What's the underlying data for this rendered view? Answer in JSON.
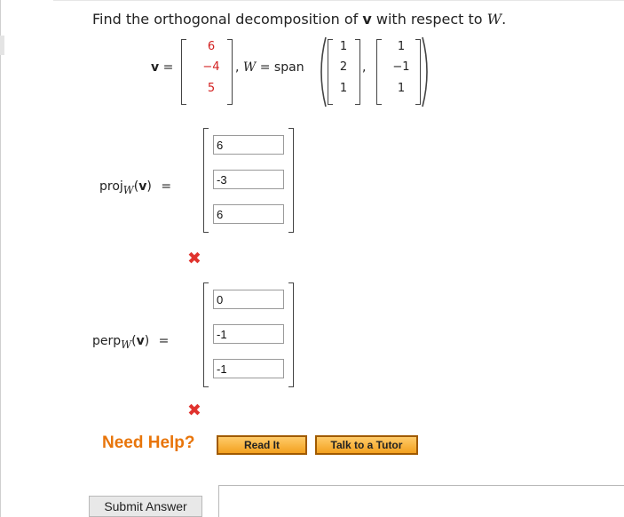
{
  "question": {
    "prefix": "Find the orthogonal decomposition of",
    "vector_symbol": "v",
    "middle": "with respect to",
    "subspace_symbol": "W",
    "suffix": "."
  },
  "vector_v": {
    "label_symbol": "v",
    "equals": "=",
    "entries": [
      "6",
      "−4",
      "5"
    ]
  },
  "subspace_W": {
    "label": "W",
    "equals_span": "= span",
    "basis1": [
      "1",
      "2",
      "1"
    ],
    "basis2": [
      "1",
      "−1",
      "1"
    ],
    "separator": ","
  },
  "proj": {
    "label_prefix": "proj",
    "subscript": "W",
    "arg_open": "(",
    "arg_symbol": "v",
    "arg_close": ")",
    "equals": "=",
    "inputs": [
      "6",
      "-3",
      "6"
    ],
    "status_icon": "incorrect-x-icon"
  },
  "perp": {
    "label_prefix": "perp",
    "subscript": "W",
    "arg_open": "(",
    "arg_symbol": "v",
    "arg_close": ")",
    "equals": "=",
    "inputs": [
      "0",
      "-1",
      "-1"
    ],
    "status_icon": "incorrect-x-icon"
  },
  "help": {
    "need_help": "Need Help?",
    "read_it": "Read It",
    "talk_to_tutor": "Talk to a Tutor"
  },
  "submit": {
    "label": "Submit Answer"
  },
  "colors": {
    "vector_entries": "#d21e1e",
    "incorrect": "#e0322d",
    "need_help": "#e8750a",
    "help_button": "#f3a11f"
  }
}
